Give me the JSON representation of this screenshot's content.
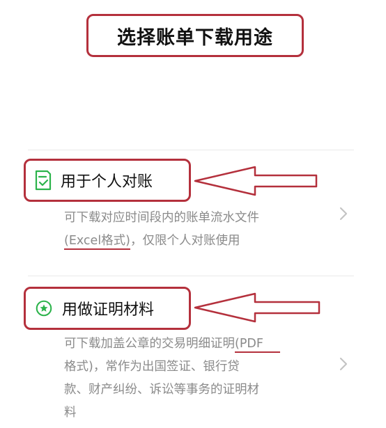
{
  "header": {
    "title": "选择账单下载用途"
  },
  "options": [
    {
      "label": "用于个人对账",
      "icon": "document-check-icon",
      "description": "可下载对应时间段内的账单流水文件",
      "format_note": "(Excel格式)",
      "extra": "，仅限个人对账使用"
    },
    {
      "label": "用做证明材料",
      "icon": "star-badge-icon",
      "description_line1": "可下载加盖公章的交易明细证明",
      "format_note": "(PDF",
      "description_line2": "格式)，常作为出国签证、银行贷",
      "description_line3": "款、财产纠纷、诉讼等事务的证明材",
      "description_line4": "料"
    }
  ],
  "colors": {
    "annotation": "#b4303c",
    "icon_green": "#2bb34a",
    "text_primary": "#111111",
    "text_secondary": "#8a8a8a"
  }
}
